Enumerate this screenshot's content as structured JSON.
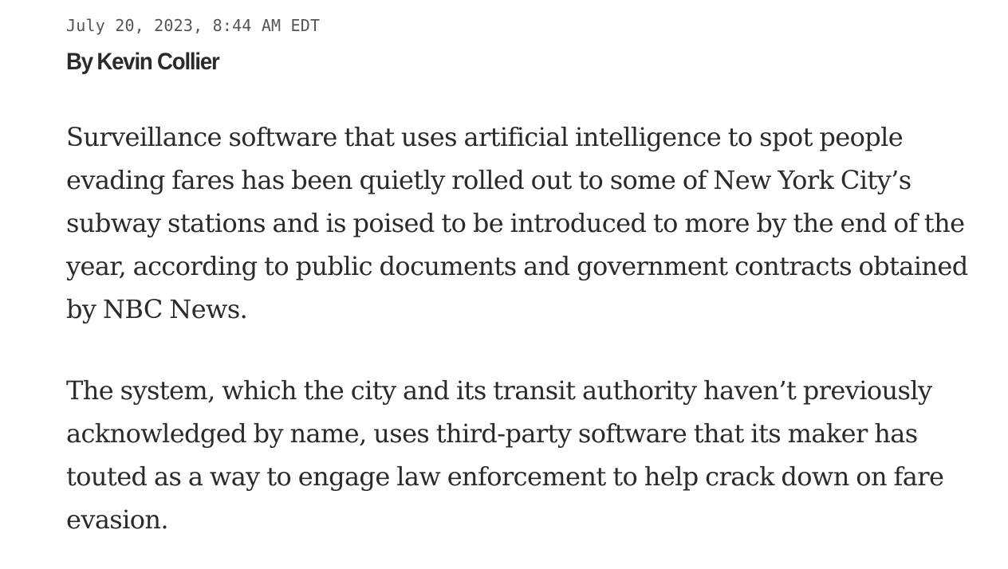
{
  "article": {
    "timestamp": "July 20, 2023, 8:44 AM EDT",
    "byline": {
      "prefix": "By",
      "author": "Kevin Collier"
    },
    "paragraphs": [
      "Surveillance software that uses artificial intelligence to spot people evading fares has been quietly rolled out to some of New York City’s subway stations and is poised to be introduced to more by the end of the year, according to public documents and government contracts obtained by NBC News.",
      "The system, which the city and its transit authority haven’t previously acknowledged by name, uses third-party software that its maker has touted as a way to engage law enforcement to help crack down on fare evasion."
    ]
  }
}
